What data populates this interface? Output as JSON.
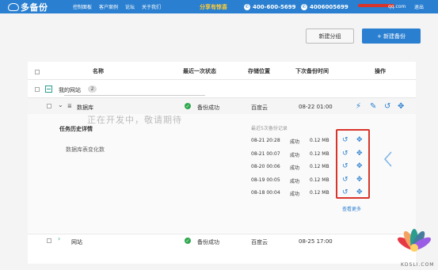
{
  "header": {
    "brand": "多备份",
    "nav": [
      "控制面板",
      "客户案例",
      "论坛",
      "关于我们"
    ],
    "promo": "分享有惊喜",
    "phone1": "400-600-5699",
    "phone2": "4006005699",
    "qq_suffix": "qq.com",
    "logout": "退出"
  },
  "toolbar": {
    "new_group": "新建分组",
    "new_backup": "+ 新建备份"
  },
  "table": {
    "columns": {
      "name": "名称",
      "last_status": "最近一次状态",
      "location": "存储位置",
      "next_time": "下次备份时间",
      "actions": "操作"
    },
    "group": {
      "name": "我的网站",
      "count": "2"
    },
    "rows": [
      {
        "name": "数据库",
        "status": "备份成功",
        "location": "百度云",
        "next": "08-22 01:00"
      },
      {
        "name": "网站",
        "status": "备份成功",
        "location": "百度云",
        "next": "08-25 17:00"
      }
    ]
  },
  "detail": {
    "title": "任务历史详情",
    "field_label": "数据库表变化数",
    "dev_msg": "正在开发中，敬请期待",
    "records_title": "最近5次备份记录",
    "records": [
      {
        "time": "08-21 20:28",
        "status": "成功",
        "size": "0.12 MB"
      },
      {
        "time": "08-21 00:07",
        "status": "成功",
        "size": "0.12 MB"
      },
      {
        "time": "08-20 00:06",
        "status": "成功",
        "size": "0.12 MB"
      },
      {
        "time": "08-19 00:05",
        "status": "成功",
        "size": "0.12 MB"
      },
      {
        "time": "08-18 00:04",
        "status": "成功",
        "size": "0.12 MB"
      }
    ],
    "view_more": "查看更多"
  },
  "watermark": "KDSLI.COM",
  "colors": {
    "primary": "#2a7fd0",
    "success": "#2fa84f",
    "highlight": "#d9342b",
    "promo": "#ffcc33"
  }
}
